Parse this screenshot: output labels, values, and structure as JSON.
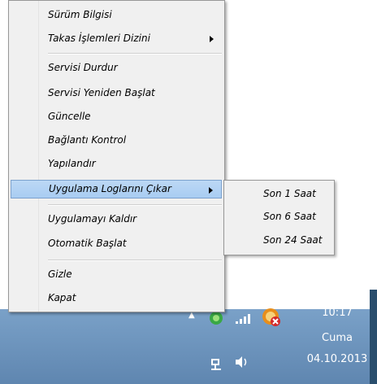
{
  "menu": {
    "items": [
      {
        "label": "Sürüm Bilgisi"
      },
      {
        "label": "Takas İşlemleri Dizini",
        "has_submenu": true
      },
      {
        "label": "Servisi Durdur"
      },
      {
        "label": "Servisi Yeniden Başlat"
      },
      {
        "label": "Güncelle"
      },
      {
        "label": "Bağlantı Kontrol"
      },
      {
        "label": "Yapılandır"
      },
      {
        "label": "Uygulama Loglarını Çıkar",
        "has_submenu": true,
        "highlighted": true
      },
      {
        "label": "Uygulamayı Kaldır"
      },
      {
        "label": "Otomatik Başlat"
      },
      {
        "label": "Gizle"
      },
      {
        "label": "Kapat"
      }
    ]
  },
  "submenu": {
    "items": [
      {
        "label": "Son 1 Saat"
      },
      {
        "label": "Son 6 Saat"
      },
      {
        "label": "Son 24 Saat"
      }
    ]
  },
  "taskbar": {
    "time": "10:17",
    "day": "Cuma",
    "date": "04.10.2013"
  },
  "icons": {
    "tray": [
      "up-arrow-icon",
      "green-app-icon",
      "signal-bars-icon",
      "app-error-icon",
      "network-icon",
      "volume-icon"
    ]
  }
}
